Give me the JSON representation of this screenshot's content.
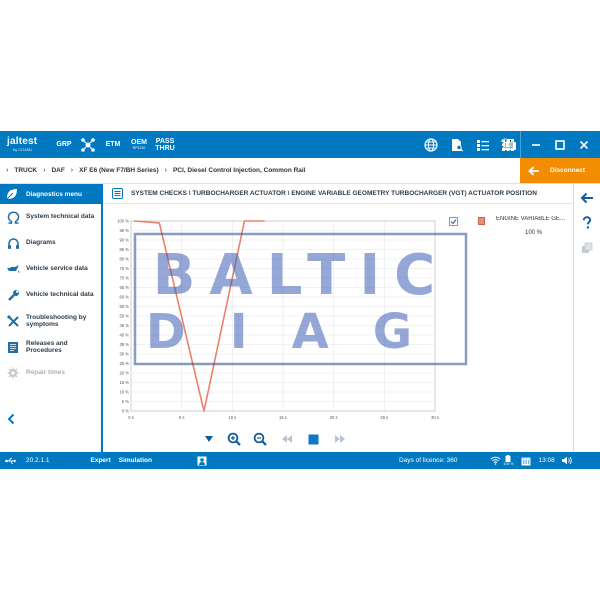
{
  "app": {
    "logo_main": "jaltest",
    "logo_sub": "by COJALI"
  },
  "toolbar": {
    "grp_label": "GRP",
    "etm_label": "ETM",
    "oem_label": "OEM",
    "oem_sub": "RP1210",
    "pass_label_1": "PASS",
    "pass_label_2": "THRU",
    "icons": [
      "globe-icon",
      "document-search-icon",
      "checklist-icon",
      "keyboard-icon",
      "printer-icon",
      "camera-icon",
      "help-icon",
      "apps-grid-icon"
    ]
  },
  "window": {
    "icons": [
      "minimize-icon",
      "maximize-icon",
      "close-icon"
    ]
  },
  "breadcrumb": {
    "items": [
      "TRUCK",
      "DAF",
      "XF E6 (New F7/BH Series)",
      "PCI, Diesel Control Injection, Common Rail"
    ]
  },
  "disconnect": {
    "label": "Disconnect"
  },
  "sidebar": {
    "header": "Diagnostics menu",
    "items": [
      {
        "label": "System technical data",
        "icon": "omega-icon",
        "enabled": true
      },
      {
        "label": "Diagrams",
        "icon": "headphones-icon",
        "enabled": true
      },
      {
        "label": "Vehicle service data",
        "icon": "oil-can-icon",
        "enabled": true
      },
      {
        "label": "Vehicle technical data",
        "icon": "wrench-icon",
        "enabled": true
      },
      {
        "label": "Troubleshooting by symptoms",
        "icon": "tools-icon",
        "enabled": true
      },
      {
        "label": "Releases and Procedures",
        "icon": "book-icon",
        "enabled": true
      },
      {
        "label": "Repair times",
        "icon": "gear-icon",
        "enabled": false
      }
    ]
  },
  "main": {
    "title": "SYSTEM CHECKS \\ TURBOCHARGER ACTUATOR \\ ENGINE VARIABLE GEOMETRY TURBOCHARGER (VGT) ACTUATOR POSITION"
  },
  "legend": {
    "series_name": "ENGINE VARIABLE GE...",
    "series_value": "100 %"
  },
  "controls": {
    "icons": [
      "collapse-down-icon",
      "zoom-in-icon",
      "zoom-out-icon",
      "rewind-icon",
      "stop-icon",
      "fast-forward-icon"
    ]
  },
  "statusbar": {
    "version": "20.2.1.1",
    "mode": "Expert",
    "simulation": "Simulation",
    "licence": "Days of licence: 360",
    "battery": "100 %",
    "time": "13:08"
  },
  "watermark": {
    "line1": "BALTIC",
    "line2": "DIAG"
  },
  "colors": {
    "brand_blue": "#0079c1",
    "accent_orange": "#f28c00",
    "series_line": "#e8826c"
  },
  "chart_data": {
    "type": "line",
    "xlabel": "",
    "ylabel": "",
    "xlim": [
      0,
      30
    ],
    "ylim": [
      0,
      100
    ],
    "x_ticks": [
      "0 s",
      "5 s",
      "10 s",
      "15 s",
      "20 s",
      "25 s",
      "30 s"
    ],
    "y_ticks": [
      "0 %",
      "5 %",
      "10 %",
      "15 %",
      "20 %",
      "25 %",
      "30 %",
      "35 %",
      "40 %",
      "45 %",
      "50 %",
      "55 %",
      "60 %",
      "65 %",
      "70 %",
      "75 %",
      "80 %",
      "85 %",
      "90 %",
      "95 %",
      "100 %"
    ],
    "grid": true,
    "series": [
      {
        "name": "ENGINE VARIABLE GE...",
        "x": [
          0.3,
          2.8,
          7.2,
          11.2,
          13.2
        ],
        "y": [
          100,
          99,
          0,
          100,
          100
        ]
      }
    ]
  }
}
